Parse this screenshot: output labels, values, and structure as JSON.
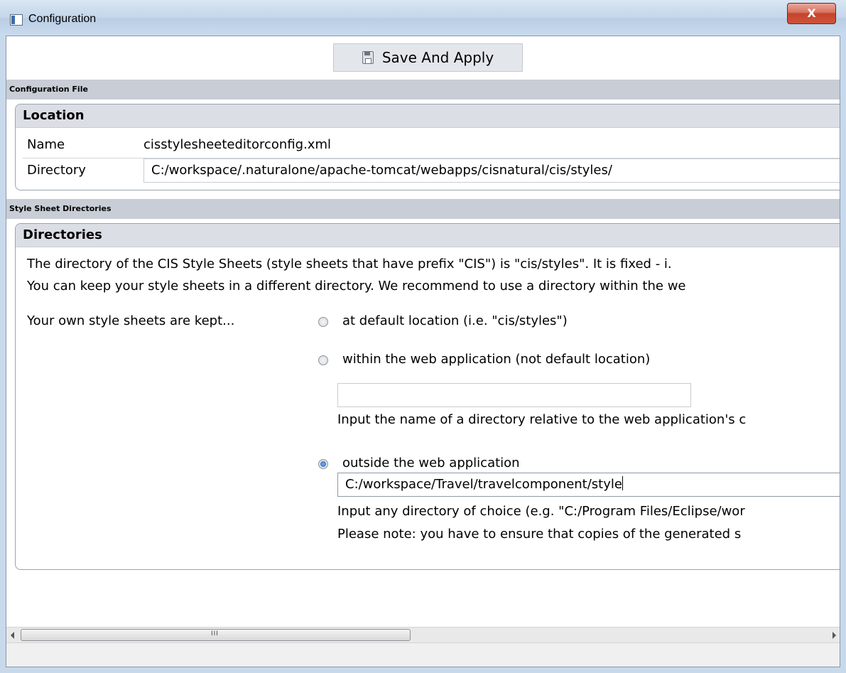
{
  "window": {
    "title": "Configuration",
    "close_label": "X"
  },
  "toolbar": {
    "save_label": "Save And Apply"
  },
  "config_file": {
    "section_label": "Configuration File",
    "group_title": "Location",
    "name_label": "Name",
    "name_value": "cisstylesheeteditorconfig.xml",
    "directory_label": "Directory",
    "directory_value": "C:/workspace/.naturalone/apache-tomcat/webapps/cisnatural/cis/styles/"
  },
  "stylesheet_dirs": {
    "section_label": "Style Sheet Directories",
    "group_title": "Directories",
    "info_line1": "The directory of the CIS Style Sheets (style sheets that have prefix \"CIS\") is \"cis/styles\". It is fixed - i.",
    "info_line2": "You can keep your style sheets in a different directory. We recommend to use a directory within the we",
    "kept_label": "Your own style sheets are kept...",
    "options": [
      {
        "label": "at  default location (i.e. \"cis/styles\")",
        "checked": false
      },
      {
        "label": "within the web application (not default location)",
        "checked": false
      },
      {
        "label": "outside the web application",
        "checked": true
      }
    ],
    "within_input_value": "",
    "within_hint": "Input the name of a directory relative to the web application's c",
    "outside_input_value": "C:/workspace/Travel/travelcomponent/style",
    "outside_hint1": "Input any directory of choice (e.g. \"C:/Program Files/Eclipse/wor",
    "outside_hint2": "Please note: you have to ensure that copies of the generated s"
  },
  "scrollbar": {
    "grip": "III"
  },
  "colors": {
    "section_bg": "#c8cdd6",
    "group_title_bg": "#dbdfe5",
    "close_red": "#c4432c",
    "radio_checked": "#1f5fb4"
  }
}
